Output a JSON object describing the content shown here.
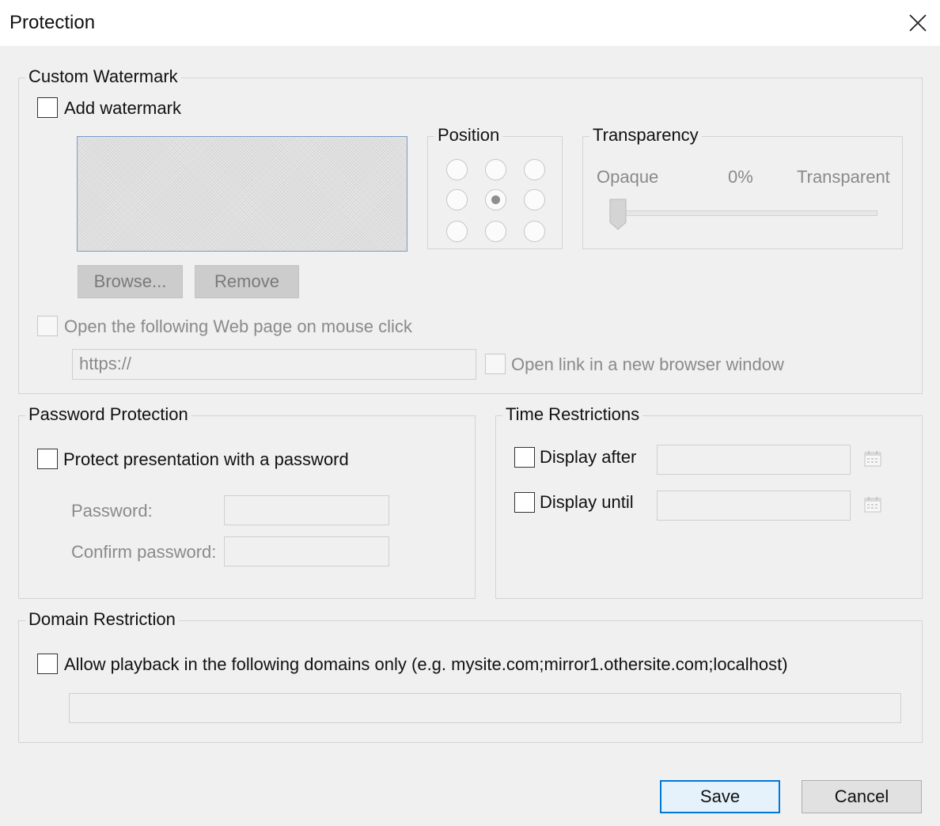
{
  "window": {
    "title": "Protection"
  },
  "watermark": {
    "group_label": "Custom Watermark",
    "add_label": "Add watermark",
    "position": {
      "label": "Position",
      "selected": "center"
    },
    "transparency": {
      "label": "Transparency",
      "left_label": "Opaque",
      "value_label": "0%",
      "right_label": "Transparent",
      "value": 0
    },
    "browse_label": "Browse...",
    "remove_label": "Remove",
    "open_page_label": "Open the following Web page on mouse click",
    "url_value": "https://",
    "new_window_label": "Open link in a new browser window"
  },
  "password": {
    "group_label": "Password Protection",
    "protect_label": "Protect presentation with a password",
    "password_label": "Password:",
    "confirm_label": "Confirm password:",
    "password_value": "",
    "confirm_value": ""
  },
  "time": {
    "group_label": "Time Restrictions",
    "after_label": "Display after",
    "until_label": "Display until",
    "after_value": "",
    "until_value": ""
  },
  "domain": {
    "group_label": "Domain Restriction",
    "allow_label": "Allow playback in the following domains only (e.g. mysite.com;mirror1.othersite.com;localhost)",
    "domains_value": ""
  },
  "footer": {
    "save_label": "Save",
    "cancel_label": "Cancel"
  },
  "colors": {
    "background": "#f0f0f0",
    "titlebar": "#ffffff",
    "default_button_border": "#0078d7",
    "disabled_text": "#8a8a8a"
  },
  "icons": [
    "close-icon",
    "calendar-icon",
    "slider-thumb-icon"
  ]
}
